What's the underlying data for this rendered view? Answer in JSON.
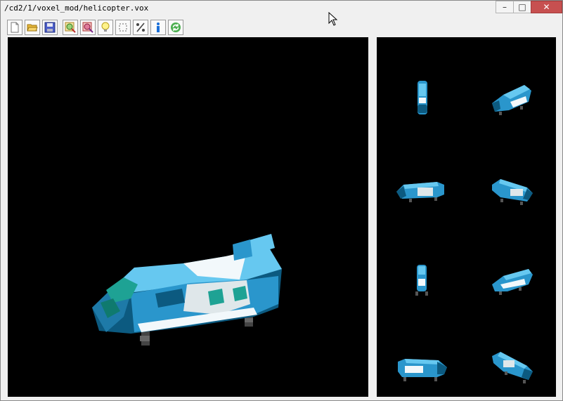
{
  "window": {
    "title": "/cd2/1/voxel_mod/helicopter.vox",
    "minimize_glyph": "–",
    "maximize_glyph": "□",
    "close_glyph": "✕"
  },
  "toolbar": {
    "buttons": [
      {
        "icon": "new-file-icon"
      },
      {
        "icon": "open-folder-icon"
      },
      {
        "icon": "save-disk-icon"
      },
      {
        "icon": "zoom-in-icon"
      },
      {
        "icon": "zoom-out-icon"
      },
      {
        "icon": "light-bulb-icon"
      },
      {
        "icon": "selection-icon"
      },
      {
        "icon": "percent-icon"
      },
      {
        "icon": "info-icon"
      },
      {
        "icon": "refresh-icon"
      }
    ]
  },
  "main_view": {
    "model": "helicopter",
    "background": "#000000"
  },
  "previews": {
    "count": 8,
    "background": "#000000"
  },
  "colors": {
    "hull_light": "#66c8f0",
    "hull_mid": "#2a96cc",
    "hull_dark": "#0c5a80",
    "hull_white": "#f2f8fb",
    "glass": "#1ea294",
    "gear": "#555555"
  }
}
